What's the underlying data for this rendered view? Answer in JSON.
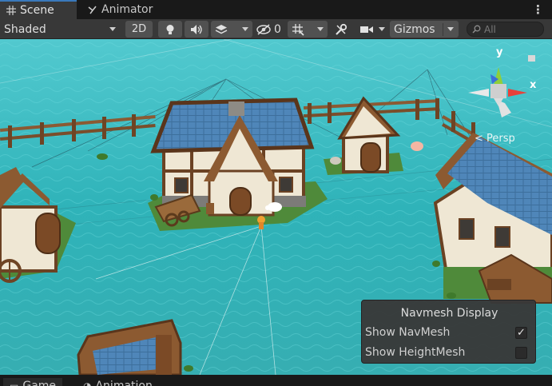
{
  "tabs": [
    {
      "label": "Scene",
      "icon": "grid-icon",
      "active": true
    },
    {
      "label": "Animator",
      "icon": "animator-icon",
      "active": false
    }
  ],
  "toolbar": {
    "shading_mode": "Shaded",
    "mode_2d": "2D",
    "hidden_count": "0",
    "gizmos_label": "Gizmos",
    "search_placeholder": "All"
  },
  "scene": {
    "gizmo_labels": {
      "y": "y",
      "x": "x"
    },
    "projection": "Persp"
  },
  "navmesh_display": {
    "title": "Navmesh Display",
    "rows": [
      {
        "label": "Show NavMesh",
        "checked": true,
        "mark": "✓"
      },
      {
        "label": "Show HeightMesh",
        "checked": false,
        "mark": ""
      }
    ]
  },
  "bottom_tabs": [
    {
      "label": "Game",
      "icon": "game-icon"
    },
    {
      "label": "Animation",
      "icon": "animation-icon"
    }
  ],
  "colors": {
    "water": "#2fb3b9",
    "tab_accent": "#3a79bb",
    "gizmo_y": "#8fce3a",
    "gizmo_x": "#e8413a",
    "gizmo_z": "#3b6fd8"
  }
}
